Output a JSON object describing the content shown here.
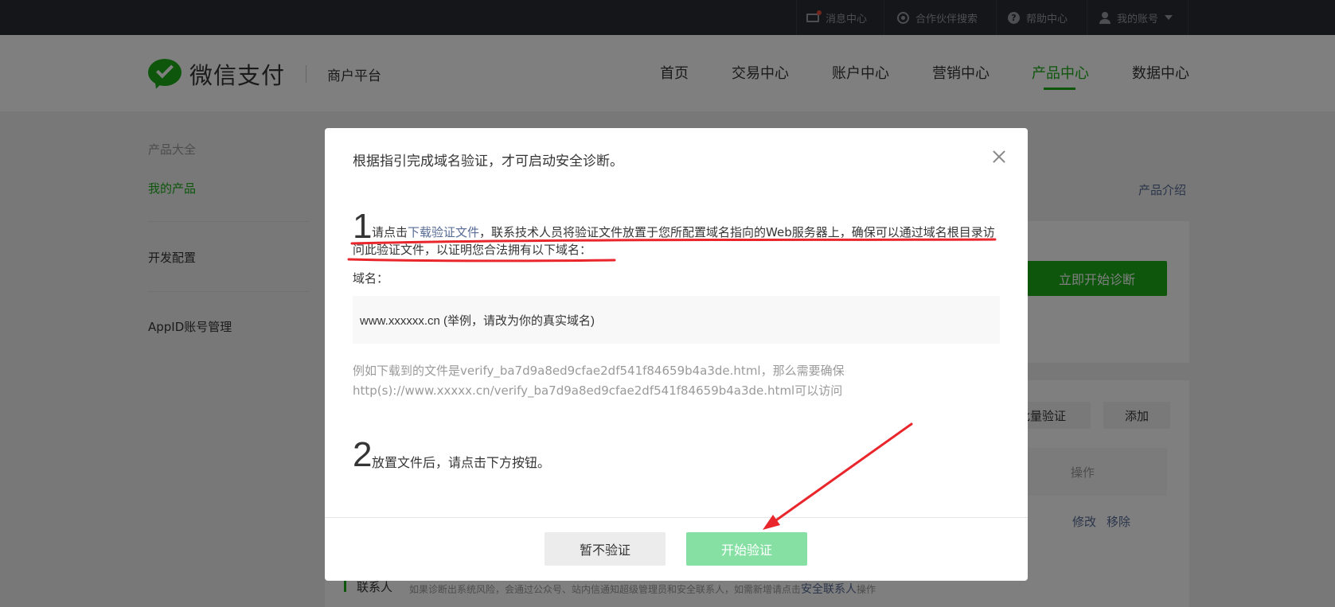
{
  "topbar": {
    "messages": "消息中心",
    "partner_search": "合作伙伴搜索",
    "help": "帮助中心",
    "account": "我的账号"
  },
  "header": {
    "logo_text": "微信支付",
    "subtitle": "商户平台",
    "nav": [
      "首页",
      "交易中心",
      "账户中心",
      "营销中心",
      "产品中心",
      "数据中心"
    ],
    "active_nav": "产品中心"
  },
  "sidebar": {
    "title": "产品大全",
    "items": [
      "我的产品",
      "开发配置",
      "AppID账号管理"
    ]
  },
  "background": {
    "product_intro": "产品介绍",
    "start_diagnosis": "立即开始诊断",
    "batch_verify": "批量验证",
    "add": "添加",
    "operation_header": "操作",
    "edit": "修改",
    "remove": "移除",
    "contact_title": "联系人",
    "contact_desc": "如果诊断出系统风险，会通过公众号、站内信通知超级管理员和安全联系人，如需新增请点击",
    "contact_link": "安全联系人",
    "contact_tail": "操作"
  },
  "modal": {
    "title": "根据指引完成域名验证，才可启动安全诊断。",
    "step1_num": "1",
    "step1_prefix": "请点击",
    "step1_link": "下载验证文件",
    "step1_rest": "，联系技术人员将验证文件放置于您所配置域名指向的Web服务器上，确保可以通过域名根目录访问此验证文件，以证明您合法拥有以下域名：",
    "domain_label": "域名：",
    "domain_value": "www.xxxxxx.cn (举例，请改为你的真实域名)",
    "example_line1": "例如下载到的文件是verify_ba7d9a8ed9cfae2df541f84659b4a3de.html，那么需要确保",
    "example_line2": "http(s)://www.xxxxx.cn/verify_ba7d9a8ed9cfae2df541f84659b4a3de.html可以访问",
    "step2_num": "2",
    "step2_text": "放置文件后，请点击下方按钮。",
    "cancel_button": "暂不验证",
    "start_button": "开始验证"
  },
  "colors": {
    "brand_green": "#1aad19",
    "link_blue": "#576b95",
    "annotation_red": "#e8262b",
    "disabled_green": "#86e0a4"
  }
}
